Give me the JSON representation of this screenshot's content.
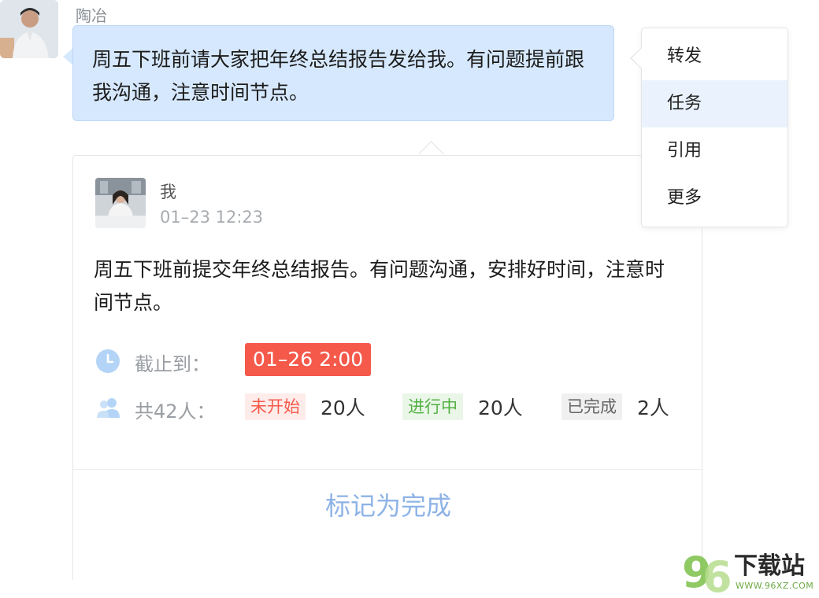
{
  "sender": {
    "name": "陶冶",
    "message": "周五下班前请大家把年终总结报告发给我。有问题提前跟我沟通，注意时间节点。"
  },
  "context_menu": {
    "items": [
      {
        "label": "转发",
        "active": false
      },
      {
        "label": "任务",
        "active": true
      },
      {
        "label": "引用",
        "active": false
      },
      {
        "label": "更多",
        "active": false
      }
    ]
  },
  "task_card": {
    "author": "我",
    "time": "01–23 12:23",
    "content": "周五下班前提交年终总结报告。有问题沟通，安排好时间，注意时间节点。",
    "deadline_label": "截止到：",
    "deadline": "01–26 2:00",
    "participants_label": "共42人：",
    "statuses": [
      {
        "label": "未开始",
        "count": "20人",
        "color": "#f5594a",
        "bg": "#fdecea"
      },
      {
        "label": "进行中",
        "count": "20人",
        "color": "#52b042",
        "bg": "#eaf6e8"
      },
      {
        "label": "已完成",
        "count": "2人",
        "color": "#666666",
        "bg": "#f0f0f0"
      }
    ],
    "action": "标记为完成"
  },
  "watermark": {
    "logo_text": "96",
    "site_name": "下载站",
    "url": "WWW.96XZ.COM"
  },
  "colors": {
    "bubble_bg": "#d6e8fd",
    "deadline_bg": "#f5594a",
    "action_text": "#8eb3e6",
    "icon_blue": "#b3d4f7"
  }
}
